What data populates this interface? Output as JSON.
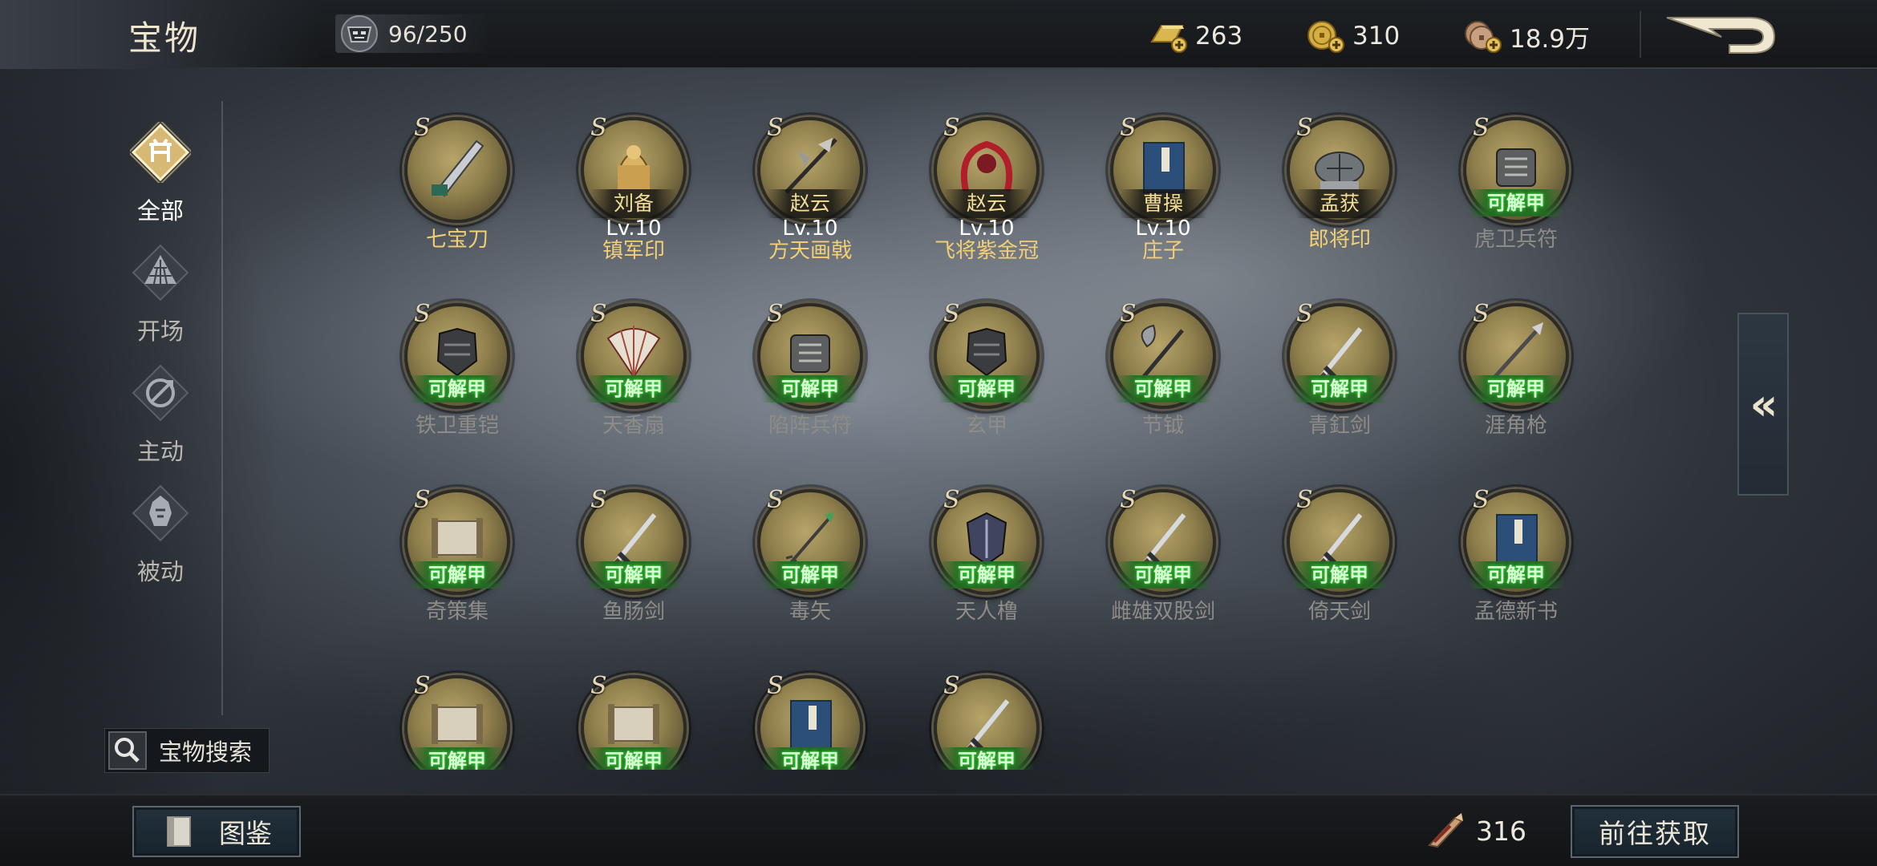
{
  "header": {
    "title": "宝物",
    "capacity": "96/250",
    "currencies": [
      {
        "icon": "gold-ingot-icon",
        "value": "263"
      },
      {
        "icon": "gold-coin-icon",
        "value": "310"
      },
      {
        "icon": "copper-coin-icon",
        "value": "18.9万"
      }
    ]
  },
  "sidebar": {
    "items": [
      {
        "label": "全部",
        "icon": "all-treasure-icon",
        "active": true
      },
      {
        "label": "开场",
        "icon": "opening-icon",
        "active": false
      },
      {
        "label": "主动",
        "icon": "active-skill-icon",
        "active": false
      },
      {
        "label": "被动",
        "icon": "passive-skill-icon",
        "active": false
      }
    ],
    "search_label": "宝物搜索"
  },
  "grade_mark": "S",
  "treasures": [
    {
      "name": "七宝刀",
      "owned": true,
      "owner": "",
      "level": "",
      "unlockable": false
    },
    {
      "name": "镇军印",
      "owned": true,
      "owner": "刘备",
      "level": "Lv.10",
      "unlockable": false
    },
    {
      "name": "方天画戟",
      "owned": true,
      "owner": "赵云",
      "level": "Lv.10",
      "unlockable": false
    },
    {
      "name": "飞将紫金冠",
      "owned": true,
      "owner": "赵云",
      "level": "Lv.10",
      "unlockable": false
    },
    {
      "name": "庄子",
      "owned": true,
      "owner": "曹操",
      "level": "Lv.10",
      "unlockable": false
    },
    {
      "name": "郎将印",
      "owned": true,
      "owner": "孟获",
      "level": "",
      "unlockable": false
    },
    {
      "name": "虎卫兵符",
      "owned": false,
      "owner": "",
      "level": "",
      "unlockable": true
    },
    {
      "name": "铁卫重铠",
      "owned": false,
      "owner": "",
      "level": "",
      "unlockable": true
    },
    {
      "name": "天香扇",
      "owned": false,
      "owner": "",
      "level": "",
      "unlockable": true
    },
    {
      "name": "陷阵兵符",
      "owned": false,
      "owner": "",
      "level": "",
      "unlockable": true
    },
    {
      "name": "玄甲",
      "owned": false,
      "owner": "",
      "level": "",
      "unlockable": true
    },
    {
      "name": "节钺",
      "owned": false,
      "owner": "",
      "level": "",
      "unlockable": true
    },
    {
      "name": "青釭剑",
      "owned": false,
      "owner": "",
      "level": "",
      "unlockable": true
    },
    {
      "name": "涯角枪",
      "owned": false,
      "owner": "",
      "level": "",
      "unlockable": true
    },
    {
      "name": "奇策集",
      "owned": false,
      "owner": "",
      "level": "",
      "unlockable": true
    },
    {
      "name": "鱼肠剑",
      "owned": false,
      "owner": "",
      "level": "",
      "unlockable": true
    },
    {
      "name": "毒矢",
      "owned": false,
      "owner": "",
      "level": "",
      "unlockable": true
    },
    {
      "name": "天人橹",
      "owned": false,
      "owner": "",
      "level": "",
      "unlockable": true
    },
    {
      "name": "雌雄双股剑",
      "owned": false,
      "owner": "",
      "level": "",
      "unlockable": true
    },
    {
      "name": "倚天剑",
      "owned": false,
      "owner": "",
      "level": "",
      "unlockable": true
    },
    {
      "name": "孟德新书",
      "owned": false,
      "owner": "",
      "level": "",
      "unlockable": true
    },
    {
      "name": "",
      "owned": false,
      "owner": "",
      "level": "",
      "unlockable": true
    },
    {
      "name": "",
      "owned": false,
      "owner": "",
      "level": "",
      "unlockable": true
    },
    {
      "name": "",
      "owned": false,
      "owner": "",
      "level": "",
      "unlockable": true
    },
    {
      "name": "",
      "owned": false,
      "owner": "",
      "level": "",
      "unlockable": true
    }
  ],
  "unlock_label": "可解甲",
  "side_tab_label": "«",
  "footer": {
    "codex_label": "图鉴",
    "token_value": "316",
    "goto_label": "前往获取"
  },
  "colors": {
    "owned_name": "#f2cf73",
    "unowned_name": "#8e8c86",
    "unlock_band": "#226e22",
    "medal_gold": "#b7a56a"
  }
}
